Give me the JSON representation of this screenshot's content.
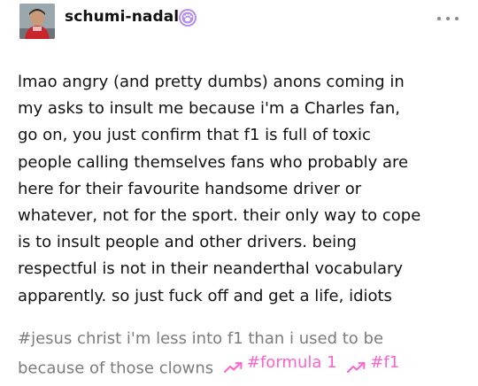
{
  "post": {
    "username": "schumi-nadal",
    "badge_icon": "paw-badge-icon",
    "more_icon": "more-options-icon",
    "body_lines": [
      "lmao angry (and pretty dumbs) anons coming in",
      "my asks to insult me because i'm a Charles fan,",
      "go on, you just confirm that f1 is full of toxic",
      "people calling themselves fans who probably are",
      "here for their favourite handsome driver or",
      "whatever, not for the sport. their only way to cope",
      "is to insult people and other drivers. being",
      "respectful is not in their neanderthal vocabulary",
      "apparently. so just fuck off and get a life, idiots"
    ],
    "tags": {
      "line1": "#jesus christ i'm less into f1 than i used to be",
      "line2": "because of those clowns",
      "trending": [
        {
          "label": "#formula 1",
          "icon": "trending-arrow-icon"
        },
        {
          "label": "#f1",
          "icon": "trending-arrow-icon"
        }
      ]
    },
    "colors": {
      "text": "#111111",
      "tag_text": "#7c7c7c",
      "trending": "#ff62ce",
      "badge": "#b48ee8"
    }
  }
}
